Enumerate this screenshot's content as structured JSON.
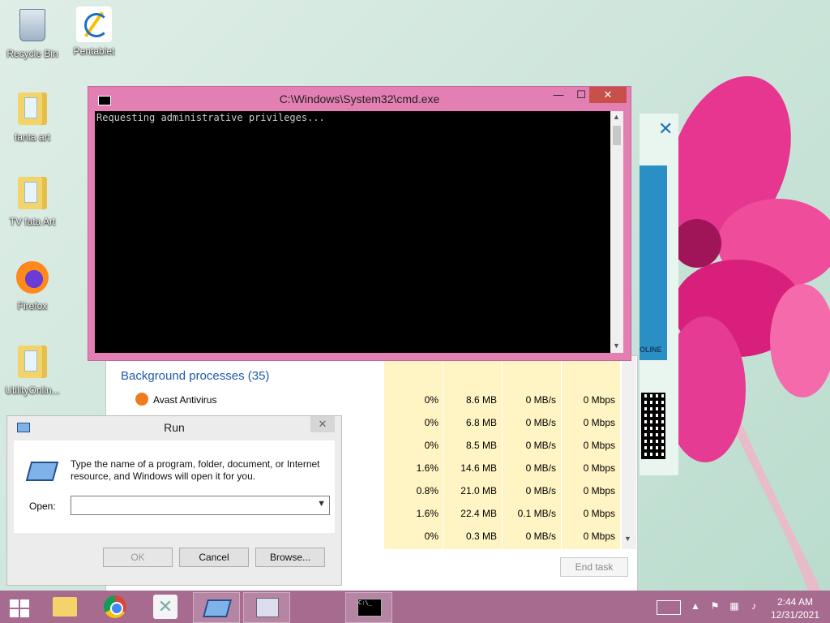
{
  "desktop": {
    "icons": [
      {
        "label": "Recycle Bin"
      },
      {
        "label": "Pentablet"
      },
      {
        "label": "fanta art"
      },
      {
        "label": "TV  fata Art"
      },
      {
        "label": "Firefox"
      },
      {
        "label": "UtilityOnlin..."
      }
    ]
  },
  "cmd": {
    "title": "C:\\Windows\\System32\\cmd.exe",
    "output": "Requesting administrative privileges...",
    "minimize": "—",
    "maximize": "☐",
    "close": "✕"
  },
  "taskmgr": {
    "section_title": "Background processes (35)",
    "rows": [
      {
        "name": "Avast Antivirus",
        "cpu": "0%",
        "mem": "8.6 MB",
        "disk": "0 MB/s",
        "net": "0 Mbps"
      },
      {
        "name": "",
        "cpu": "0%",
        "mem": "6.8 MB",
        "disk": "0 MB/s",
        "net": "0 Mbps"
      },
      {
        "name": "",
        "cpu": "0%",
        "mem": "8.5 MB",
        "disk": "0 MB/s",
        "net": "0 Mbps"
      },
      {
        "name": "",
        "cpu": "1.6%",
        "mem": "14.6 MB",
        "disk": "0 MB/s",
        "net": "0 Mbps"
      },
      {
        "name": "",
        "cpu": "0.8%",
        "mem": "21.0 MB",
        "disk": "0 MB/s",
        "net": "0 Mbps"
      },
      {
        "name": "",
        "cpu": "1.6%",
        "mem": "22.4 MB",
        "disk": "0.1 MB/s",
        "net": "0 Mbps"
      },
      {
        "name": "",
        "cpu": "0%",
        "mem": "0.3 MB",
        "disk": "0 MB/s",
        "net": "0 Mbps"
      }
    ],
    "end_task": "End task"
  },
  "sidepanel": {
    "close": "✕",
    "ad_text": "OLINE"
  },
  "run": {
    "title": "Run",
    "close": "✕",
    "description": "Type the name of a program, folder, document, or Internet resource, and Windows will open it for you.",
    "open_label": "Open:",
    "open_value": "",
    "ok": "OK",
    "cancel": "Cancel",
    "browse": "Browse..."
  },
  "taskbar": {
    "time": "2:44 AM",
    "date": "12/31/2021",
    "cmd_glyph": "C:\\_"
  },
  "colors": {
    "cmd_frame": "#e47fb3",
    "taskbar": "#a76b90",
    "accent_link": "#1e5aa8"
  }
}
